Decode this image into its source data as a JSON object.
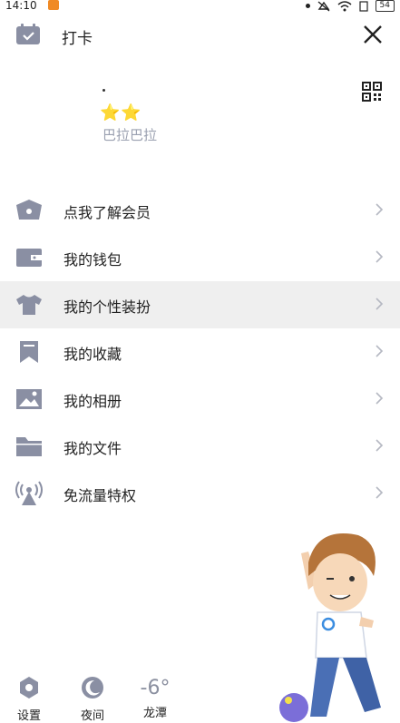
{
  "status_bar": {
    "time": "14:10",
    "battery": "54"
  },
  "top_bar": {
    "checkin_label": "打卡"
  },
  "profile": {
    "level_stars": "⭐⭐",
    "nickname": "巴拉巴拉"
  },
  "menu": {
    "items": [
      {
        "label": "点我了解会员",
        "icon": "crown-basket-icon"
      },
      {
        "label": "我的钱包",
        "icon": "wallet-icon"
      },
      {
        "label": "我的个性装扮",
        "icon": "tshirt-icon",
        "active": true
      },
      {
        "label": "我的收藏",
        "icon": "bookmark-icon"
      },
      {
        "label": "我的相册",
        "icon": "photo-icon"
      },
      {
        "label": "我的文件",
        "icon": "folder-icon"
      },
      {
        "label": "免流量特权",
        "icon": "signal-tower-icon"
      }
    ]
  },
  "bottom_bar": {
    "settings_label": "设置",
    "night_label": "夜间",
    "temperature": "-6°",
    "city": "龙潭"
  },
  "colors": {
    "icon": "#8a8fa3",
    "active_row": "#efefef",
    "nickname": "#9aa0b0"
  }
}
